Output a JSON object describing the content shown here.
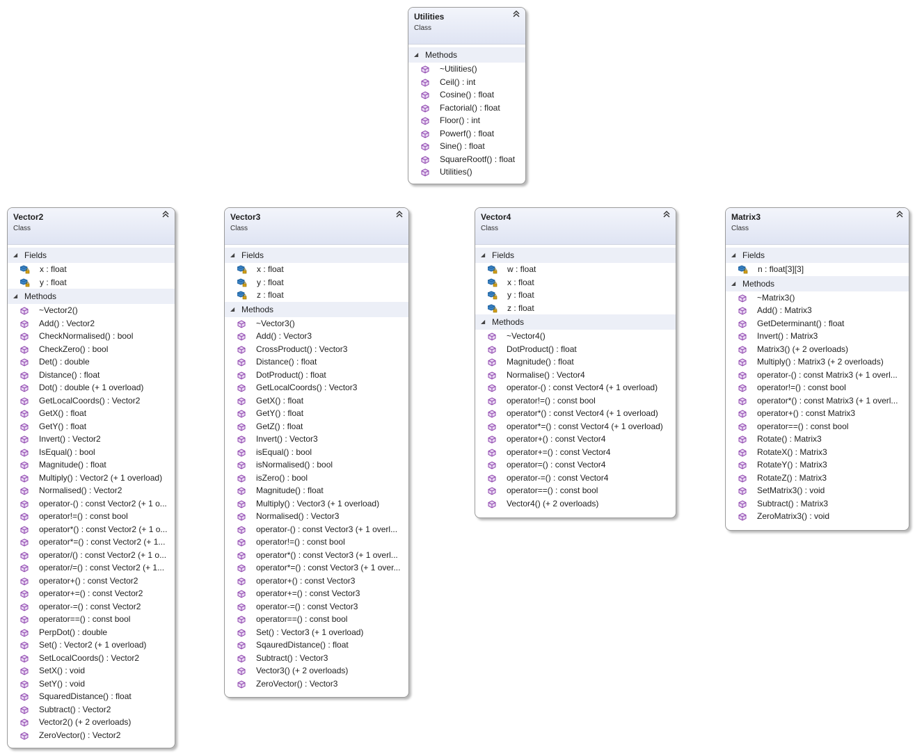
{
  "classes": [
    {
      "id": "utilities",
      "name": "Utilities",
      "kind": "Class",
      "methods_label": "Methods",
      "methods": [
        "~Utilities()",
        "Ceil() : int",
        "Cosine() : float",
        "Factorial() : float",
        "Floor() : int",
        "Powerf() : float",
        "Sine() : float",
        "SquareRootf() : float",
        "Utilities()"
      ]
    },
    {
      "id": "vector2",
      "name": "Vector2",
      "kind": "Class",
      "fields_label": "Fields",
      "fields": [
        "x : float",
        "y : float"
      ],
      "methods_label": "Methods",
      "methods": [
        "~Vector2()",
        "Add() : Vector2",
        "CheckNormalised() : bool",
        "CheckZero() : bool",
        "Det() : double",
        "Distance() : float",
        "Dot() : double (+ 1 overload)",
        "GetLocalCoords() : Vector2",
        "GetX() : float",
        "GetY() : float",
        "Invert() : Vector2",
        "IsEqual() : bool",
        "Magnitude() : float",
        "Multiply() : Vector2 (+ 1 overload)",
        "Normalised() : Vector2",
        "operator-() : const Vector2 (+ 1 o...",
        "operator!=() : const bool",
        "operator*() : const Vector2 (+ 1 o...",
        "operator*=() : const Vector2 (+ 1...",
        "operator/() : const Vector2 (+ 1 o...",
        "operator/=() : const Vector2 (+ 1...",
        "operator+() : const Vector2",
        "operator+=() : const Vector2",
        "operator-=() : const Vector2",
        "operator==() : const bool",
        "PerpDot() : double",
        "Set() : Vector2 (+ 1 overload)",
        "SetLocalCoords() : Vector2",
        "SetX() : void",
        "SetY() : void",
        "SquaredDistance() : float",
        "Subtract() : Vector2",
        "Vector2() (+ 2 overloads)",
        "ZeroVector() : Vector2"
      ]
    },
    {
      "id": "vector3",
      "name": "Vector3",
      "kind": "Class",
      "fields_label": "Fields",
      "fields": [
        "x : float",
        "y : float",
        "z : float"
      ],
      "methods_label": "Methods",
      "methods": [
        "~Vector3()",
        "Add() : Vector3",
        "CrossProduct() : Vector3",
        "Distance() : float",
        "DotProduct() : float",
        "GetLocalCoords() : Vector3",
        "GetX() : float",
        "GetY() : float",
        "GetZ() : float",
        "Invert() : Vector3",
        "isEqual() : bool",
        "isNormalised() : bool",
        "isZero() : bool",
        "Magnitude() : float",
        "Multiply() : Vector3 (+ 1 overload)",
        "Normalised() : Vector3",
        "operator-() : const Vector3 (+ 1 overl...",
        "operator!=() : const bool",
        "operator*() : const Vector3 (+ 1 overl...",
        "operator*=() : const Vector3 (+ 1 over...",
        "operator+() : const Vector3",
        "operator+=() : const Vector3",
        "operator-=() : const Vector3",
        "operator==() : const bool",
        "Set() : Vector3 (+ 1 overload)",
        "SqauredDistance() : float",
        "Subtract() : Vector3",
        "Vector3() (+ 2 overloads)",
        "ZeroVector() : Vector3"
      ]
    },
    {
      "id": "vector4",
      "name": "Vector4",
      "kind": "Class",
      "fields_label": "Fields",
      "fields": [
        "w : float",
        "x : float",
        "y : float",
        "z : float"
      ],
      "methods_label": "Methods",
      "methods": [
        "~Vector4()",
        "DotProduct() : float",
        "Magnitude() : float",
        "Normalise() : Vector4",
        "operator-() : const Vector4 (+ 1 overload)",
        "operator!=() : const bool",
        "operator*() : const Vector4 (+ 1 overload)",
        "operator*=() : const Vector4 (+ 1 overload)",
        "operator+() : const Vector4",
        "operator+=() : const Vector4",
        "operator=() : const Vector4",
        "operator-=() : const Vector4",
        "operator==() : const bool",
        "Vector4() (+ 2 overloads)"
      ]
    },
    {
      "id": "matrix3",
      "name": "Matrix3",
      "kind": "Class",
      "fields_label": "Fields",
      "fields": [
        "n : float[3][3]"
      ],
      "methods_label": "Methods",
      "methods": [
        "~Matrix3()",
        "Add() : Matrix3",
        "GetDeterminant() : float",
        "Invert() : Matrix3",
        "Matrix3() (+ 2 overloads)",
        "Multiply() : Matrix3 (+ 2 overloads)",
        "operator-() : const Matrix3 (+ 1 overl...",
        "operator!=() : const bool",
        "operator*() : const Matrix3 (+ 1 overl...",
        "operator+() : const Matrix3",
        "operator==() : const bool",
        "Rotate() : Matrix3",
        "RotateX() : Matrix3",
        "RotateY() : Matrix3",
        "RotateZ() : Matrix3",
        "SetMatrix3() : void",
        "Subtract() : Matrix3",
        "ZeroMatrix3() : void"
      ]
    }
  ],
  "icons": {
    "method": "method-cube-icon",
    "field": "field-lock-icon",
    "collapse": "double-chevron-up-icon",
    "compartment": "triangle-expanded-icon"
  },
  "colors": {
    "method_icon": "#8e44ad",
    "field_icon": "#1c5f9c",
    "field_lock": "#d4a017",
    "header_gradient_top": "#f3f5fb",
    "header_gradient_bottom": "#dfe4f3",
    "compartment_bg": "#eceff7"
  }
}
